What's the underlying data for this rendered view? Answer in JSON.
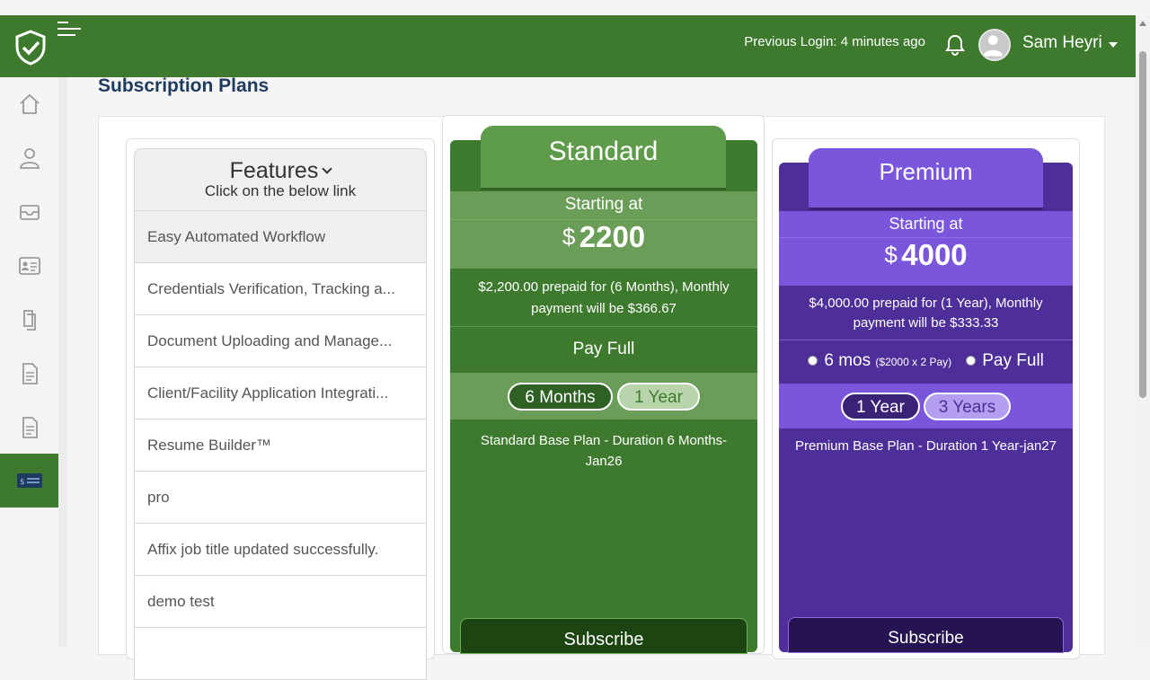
{
  "header": {
    "previous_login": "Previous Login: 4 minutes ago",
    "user_name": "Sam Heyri"
  },
  "page": {
    "title": "Subscription Plans"
  },
  "sidebar": {
    "items": [
      {
        "icon": "home-icon"
      },
      {
        "icon": "user-icon"
      },
      {
        "icon": "inbox-icon"
      },
      {
        "icon": "id-card-icon"
      },
      {
        "icon": "documents-icon"
      },
      {
        "icon": "file-icon"
      },
      {
        "icon": "file-icon"
      },
      {
        "icon": "billing-icon",
        "active": true
      }
    ]
  },
  "features": {
    "title": "Features",
    "subtitle": "Click on the below link",
    "items": [
      "Easy Automated Workflow",
      "Credentials Verification, Tracking a...",
      "Document Uploading and Manage...",
      "Client/Facility Application Integrati...",
      "Resume Builder™",
      "pro",
      "Affix job title updated successfully.",
      "demo test"
    ]
  },
  "standard": {
    "name": "Standard",
    "starting_at": "Starting at",
    "currency": "$",
    "price": "2200",
    "description": "$2,200.00 prepaid for (6 Months), Monthly payment will be $366.67",
    "pay_full": "Pay Full",
    "durations": [
      "6 Months",
      "1 Year"
    ],
    "base_plan": "Standard Base Plan - Duration 6 Months-Jan26",
    "subscribe": "Subscribe",
    "color": "#3e7a2e"
  },
  "premium": {
    "name": "Premium",
    "starting_at": "Starting at",
    "currency": "$",
    "price": "4000",
    "description": "$4,000.00 prepaid for (1 Year), Monthly payment will be $333.33",
    "option_6mos": "6 mos",
    "option_6mos_note": "($2000 x 2 Pay)",
    "option_payfull": "Pay Full",
    "durations": [
      "1 Year",
      "3 Years"
    ],
    "base_plan": "Premium Base Plan - Duration 1 Year-jan27",
    "subscribe": "Subscribe",
    "color": "#4e2f9a"
  }
}
